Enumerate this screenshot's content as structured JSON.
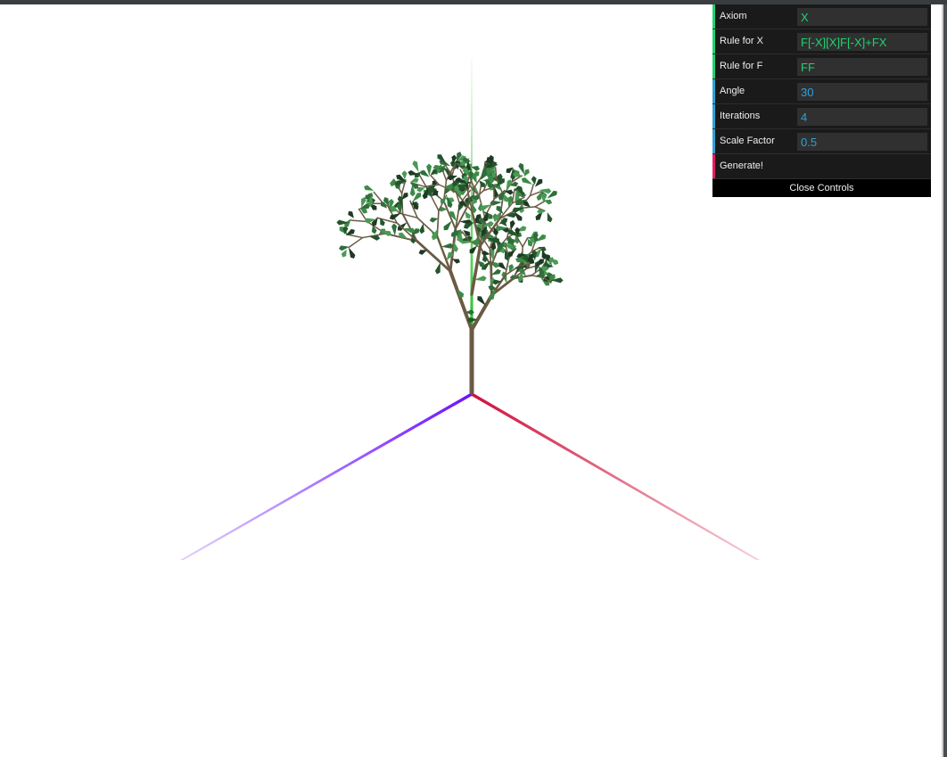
{
  "colors": {
    "string_accent": "#1ed36f",
    "number_accent": "#2fa1d6",
    "function_accent": "#e61d5f",
    "axis_x": "#d0103a",
    "axis_y": "#00b400",
    "axis_z": "#6b11ff",
    "branch": "#6b5a44",
    "leaf": "#2f6e3a"
  },
  "controls": {
    "axiom": {
      "label": "Axiom",
      "value": "X"
    },
    "rule_x": {
      "label": "Rule for X",
      "value": "F[-X][X]F[-X]+FX"
    },
    "rule_f": {
      "label": "Rule for F",
      "value": "FF"
    },
    "angle": {
      "label": "Angle",
      "value": "30"
    },
    "iterations": {
      "label": "Iterations",
      "value": "4"
    },
    "scale_factor": {
      "label": "Scale Factor",
      "value": "0.5"
    },
    "generate": {
      "label": "Generate!"
    },
    "close": {
      "label": "Close Controls"
    }
  }
}
